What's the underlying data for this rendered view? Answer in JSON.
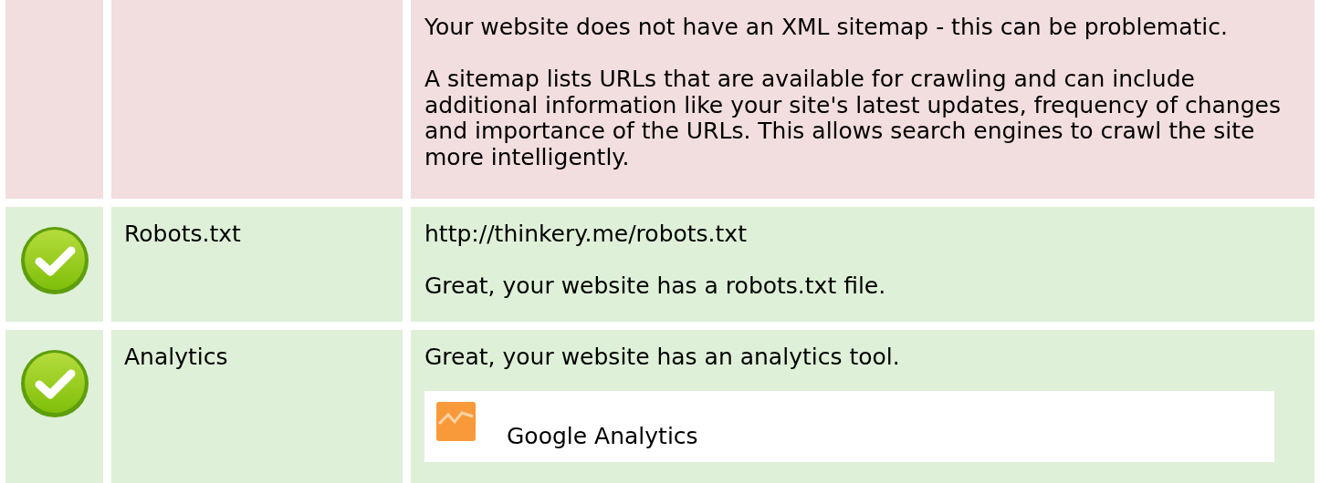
{
  "rows": [
    {
      "passed": false,
      "label": "",
      "paragraphs": [
        "Your website does not have an XML sitemap - this can be problematic.",
        "A sitemap lists URLs that are available for crawling and can include additional information like your site's latest updates, frequency of changes and importance of the URLs. This allows search engines to crawl the site more intelligently."
      ],
      "tools": []
    },
    {
      "passed": true,
      "label": "Robots.txt",
      "paragraphs": [
        "http://thinkery.me/robots.txt",
        "Great, your website has a robots.txt file."
      ],
      "tools": []
    },
    {
      "passed": true,
      "label": "Analytics",
      "paragraphs": [
        "Great, your website has an analytics tool."
      ],
      "tools": [
        "Google Analytics"
      ]
    }
  ]
}
